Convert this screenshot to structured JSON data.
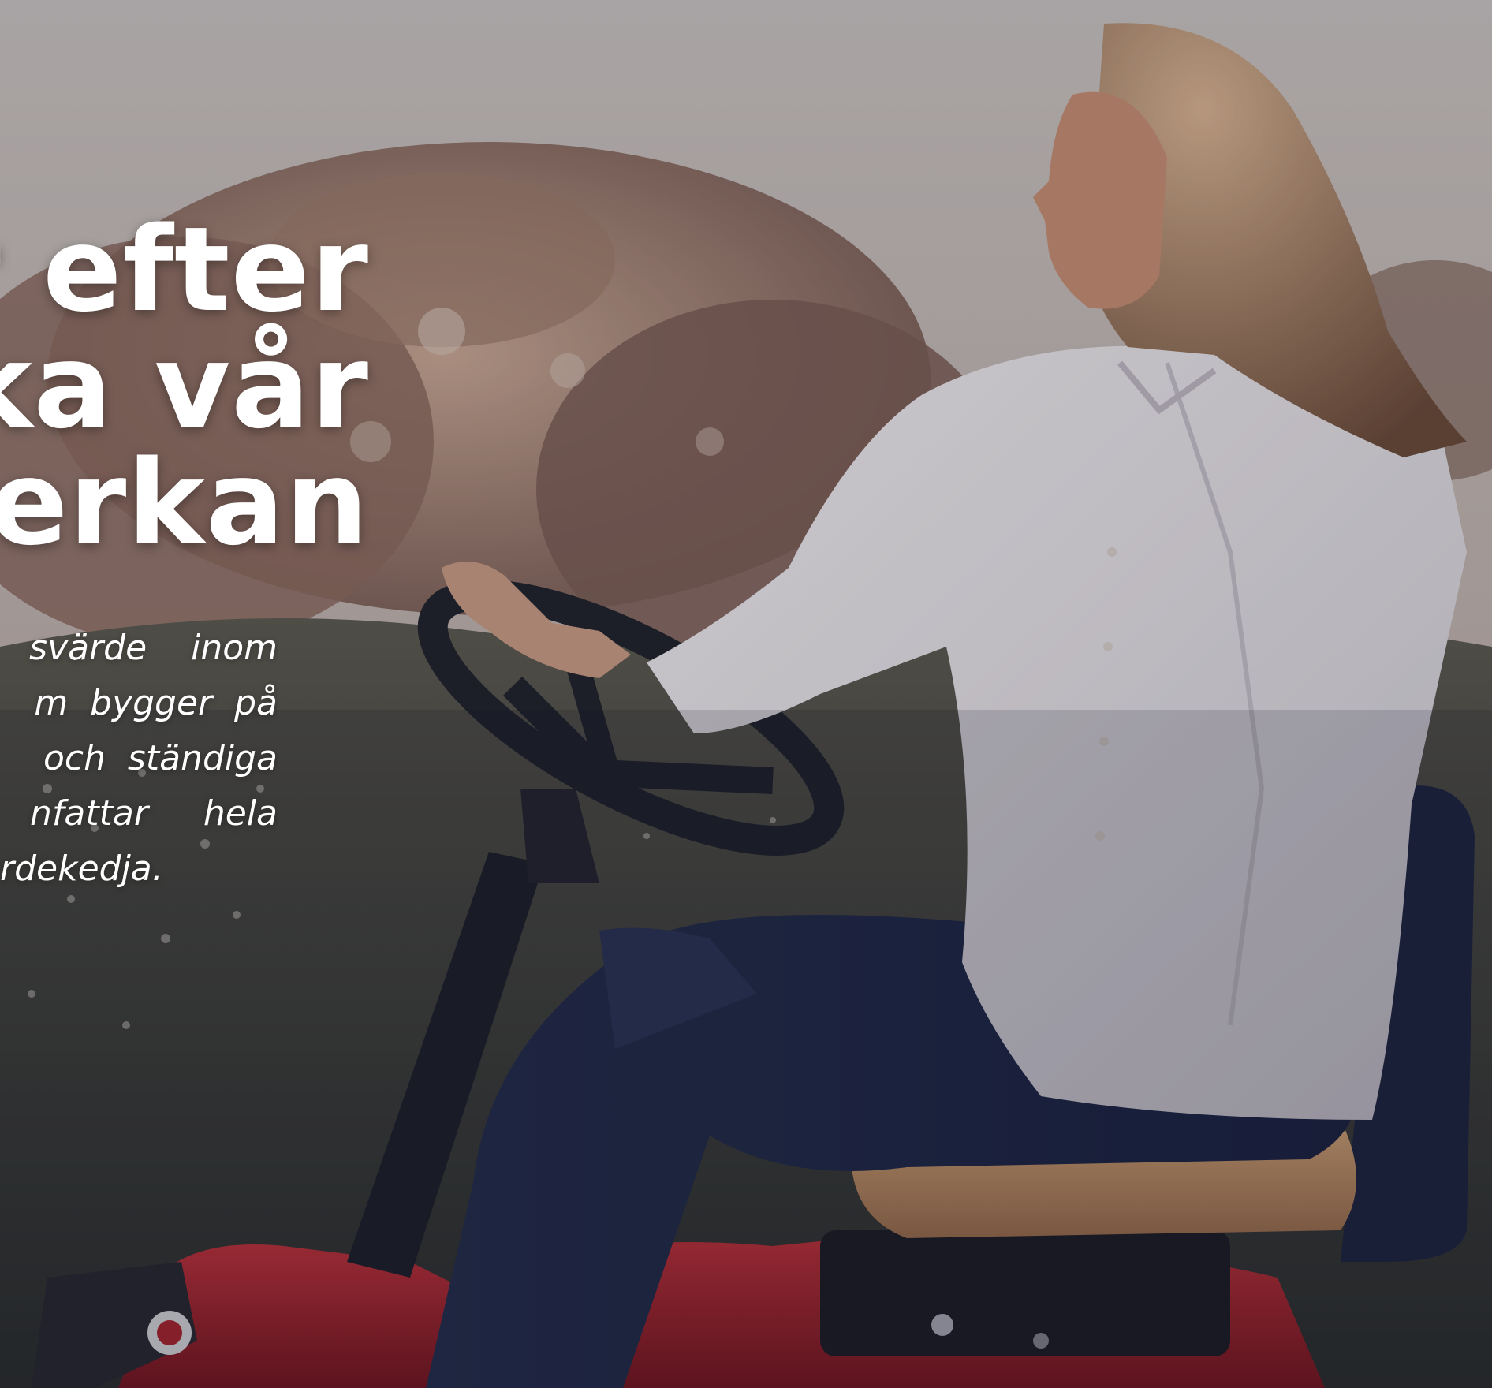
{
  "headline": {
    "lines": [
      "r efter",
      "ka vår",
      "erkan"
    ]
  },
  "body": {
    "lines": [
      "svärde    inom",
      "m  bygger  på",
      "  och  ständiga",
      "nfattar     hela",
      "rdekedja."
    ]
  },
  "colors": {
    "sky": "#c9c0b8",
    "trees": "#8a6a58",
    "meadow": "#3b4236",
    "shirt": "#eceae8",
    "jeans": "#2a3654",
    "mower_red": "#b8262a",
    "steering": "#1f2126",
    "text": "#ffffff"
  }
}
